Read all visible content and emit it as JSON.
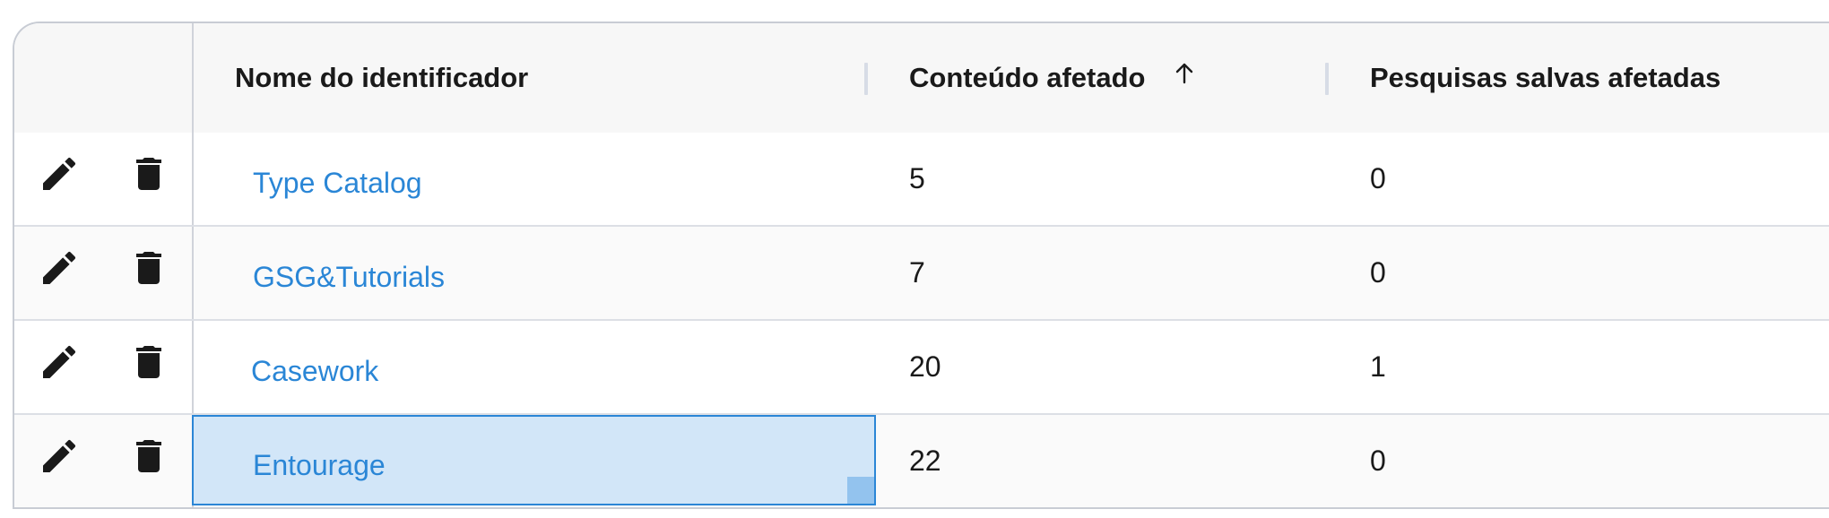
{
  "header": {
    "col_name": "Nome do identificador",
    "col_content": "Conteúdo afetado",
    "col_searches": "Pesquisas salvas afetadas",
    "sort_icon": "arrow-up-icon"
  },
  "icons": {
    "edit": "pencil-icon",
    "delete": "trash-icon"
  },
  "rows": [
    {
      "name": "Type Catalog",
      "content": "5",
      "searches": "0"
    },
    {
      "name": "GSG&Tutorials",
      "content": "7",
      "searches": "0"
    },
    {
      "name": "Casework",
      "content": "20",
      "searches": "1"
    },
    {
      "name": "Entourage",
      "content": "22",
      "searches": "0"
    }
  ],
  "colors": {
    "link": "#2a86d6",
    "selection": "#d2e6f8",
    "selection_border": "#2b86d6"
  }
}
